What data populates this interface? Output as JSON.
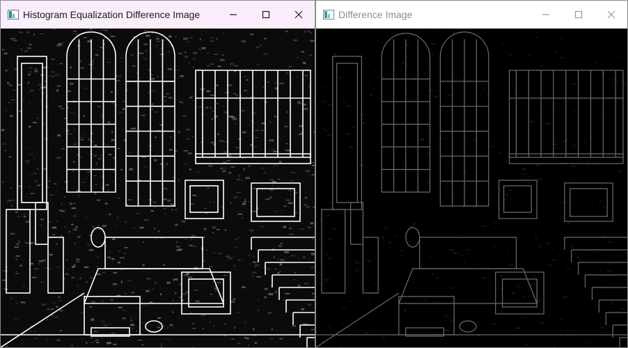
{
  "windows": [
    {
      "title": "Histogram Equalization Difference Image",
      "state": "active",
      "image": {
        "description_icon": "edge-map-image",
        "line_color": "#ffffff",
        "background_color": "#0b0b0b",
        "noise_color": "#6a6a6a"
      }
    },
    {
      "title": "Difference Image",
      "state": "inactive",
      "image": {
        "description_icon": "edge-map-image",
        "line_color": "#6e6e6e",
        "background_color": "#000000",
        "noise_color": "#1a1a1a"
      }
    }
  ],
  "controls": {
    "minimize_icon": "minimize-icon",
    "maximize_icon": "maximize-icon",
    "close_icon": "close-icon"
  }
}
